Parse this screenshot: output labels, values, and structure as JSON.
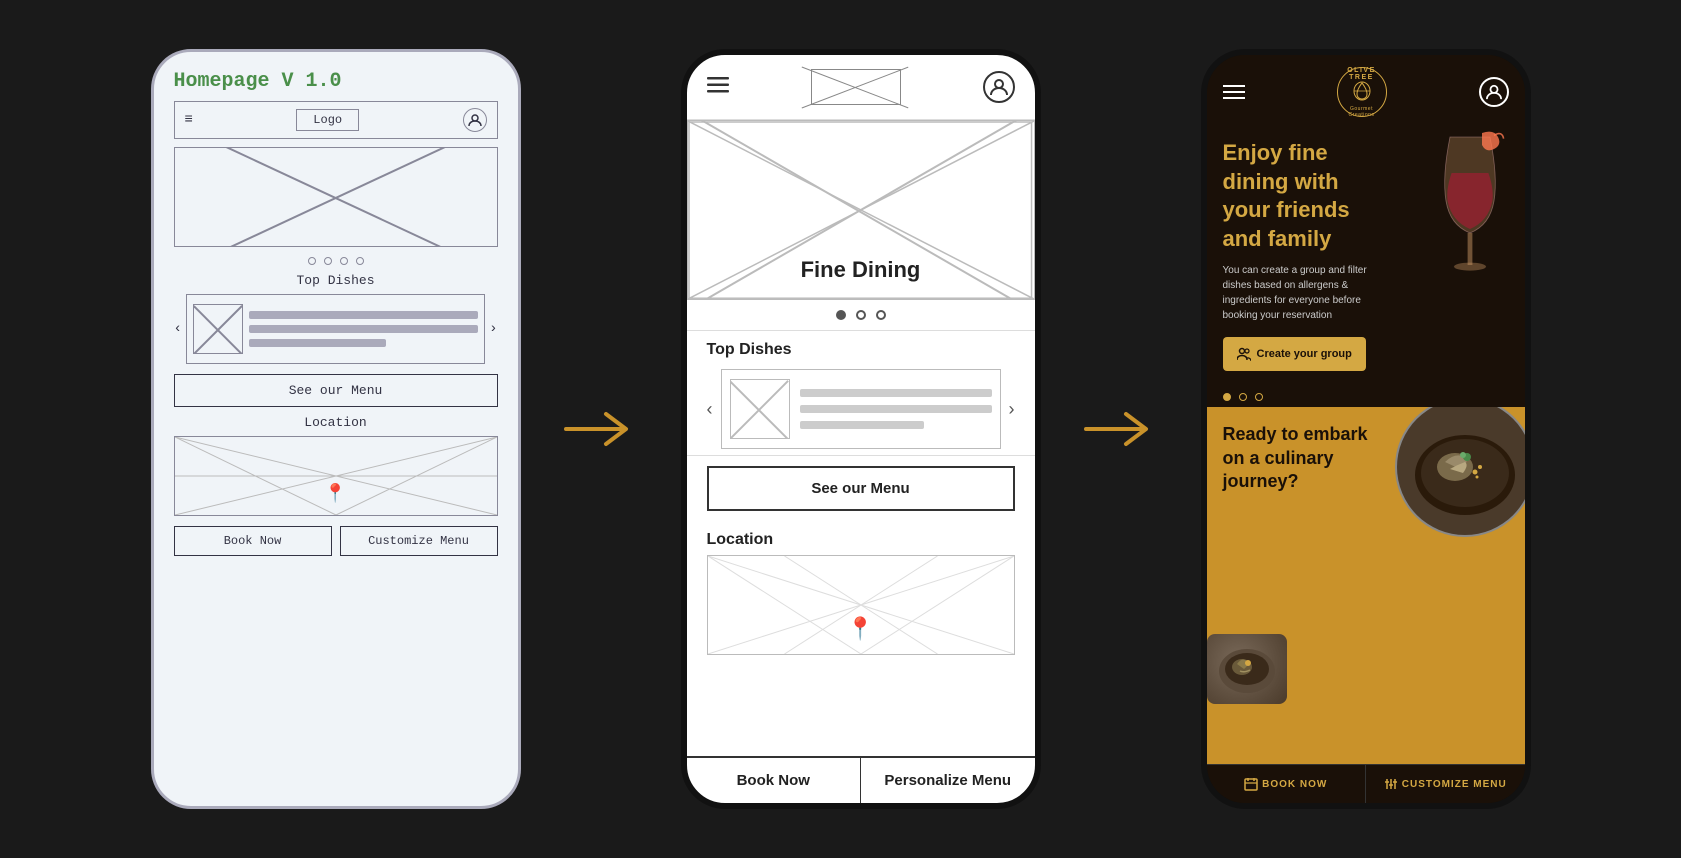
{
  "phone1": {
    "title": "Homepage V 1.0",
    "header": {
      "hamburger": "≡",
      "logo": "Logo",
      "profile": "⊕"
    },
    "dots": [
      "●",
      "●",
      "●",
      "●"
    ],
    "section1": "Top Dishes",
    "menu_btn": "See our Menu",
    "location_label": "Location",
    "bottom_btns": {
      "left": "Book Now",
      "right": "Customize Menu"
    }
  },
  "arrow1": "→",
  "phone2": {
    "header": {
      "hamburger": "≡"
    },
    "hero_text": "Fine Dining",
    "dots": [
      "filled",
      "empty",
      "empty"
    ],
    "section1": "Top Dishes",
    "menu_btn": "See our Menu",
    "location_label": "Location",
    "bottom_btns": {
      "left": "Book Now",
      "right": "Personalize Menu"
    }
  },
  "arrow2": "→",
  "phone3": {
    "logo": {
      "line1": "OLIVE TREE",
      "line2": "Gourmet Creations"
    },
    "hero": {
      "title": "Enjoy fine dining with your friends and family",
      "desc": "You can create a group and filter dishes based on allergens & ingredients for everyone before booking your reservation",
      "cta_btn": "Create your group"
    },
    "dots": [
      "filled",
      "empty",
      "empty"
    ],
    "culinary": {
      "title": "Ready to embark on a culinary journey?"
    },
    "bottom_btns": {
      "left": "BOOK NOW",
      "right": "CUSTOMIZE MENU",
      "left_icon": "📅",
      "right_icon": "🍴"
    }
  }
}
